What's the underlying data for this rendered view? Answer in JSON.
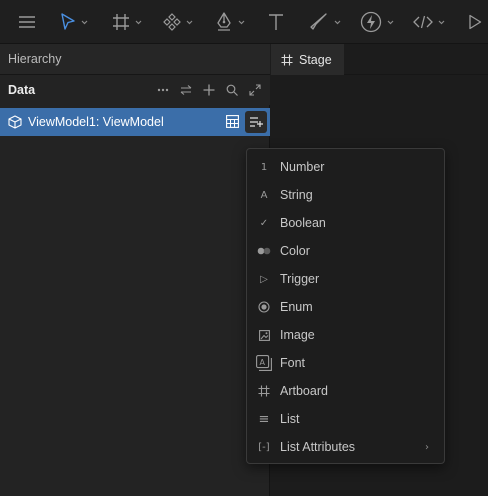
{
  "toolbar": {
    "items": [
      {
        "name": "menu-icon"
      },
      {
        "name": "select-tool-icon",
        "active": true
      },
      {
        "name": "artboard-tool-icon"
      },
      {
        "name": "component-tool-icon"
      },
      {
        "name": "pen-tool-icon"
      },
      {
        "name": "text-tool-icon"
      },
      {
        "name": "brush-tool-icon"
      },
      {
        "name": "events-icon"
      },
      {
        "name": "code-icon"
      },
      {
        "name": "play-icon"
      }
    ]
  },
  "hierarchy": {
    "title": "Hierarchy",
    "section_label": "Data",
    "actions": [
      "more-icon",
      "swap-icon",
      "add-icon",
      "search-icon",
      "expand-icon"
    ],
    "viewmodel": {
      "label": "ViewModel1: ViewModel"
    }
  },
  "stage": {
    "tab_label": "Stage"
  },
  "menu": {
    "items": [
      {
        "label": "Number",
        "icon": "1",
        "icon_name": "number-icon"
      },
      {
        "label": "String",
        "icon": "A",
        "icon_name": "string-icon"
      },
      {
        "label": "Boolean",
        "icon": "✓",
        "icon_name": "boolean-icon"
      },
      {
        "label": "Color",
        "icon": "",
        "icon_name": "color-icon"
      },
      {
        "label": "Trigger",
        "icon": "▷",
        "icon_name": "trigger-icon"
      },
      {
        "label": "Enum",
        "icon": "",
        "icon_name": "enum-icon"
      },
      {
        "label": "Image",
        "icon": "",
        "icon_name": "image-icon"
      },
      {
        "label": "Font",
        "icon": "",
        "icon_name": "font-icon"
      },
      {
        "label": "Artboard",
        "icon": "",
        "icon_name": "artboard-icon"
      },
      {
        "label": "List",
        "icon": "≡",
        "icon_name": "list-icon"
      },
      {
        "label": "List Attributes",
        "icon": "[-]",
        "icon_name": "list-attributes-icon",
        "submenu_arrow": "›"
      }
    ]
  },
  "colors": {
    "accent": "#3b6ea9",
    "active_tool": "#4a90e2",
    "panel_bg": "#232323",
    "menu_bg": "#1d1d1d"
  }
}
